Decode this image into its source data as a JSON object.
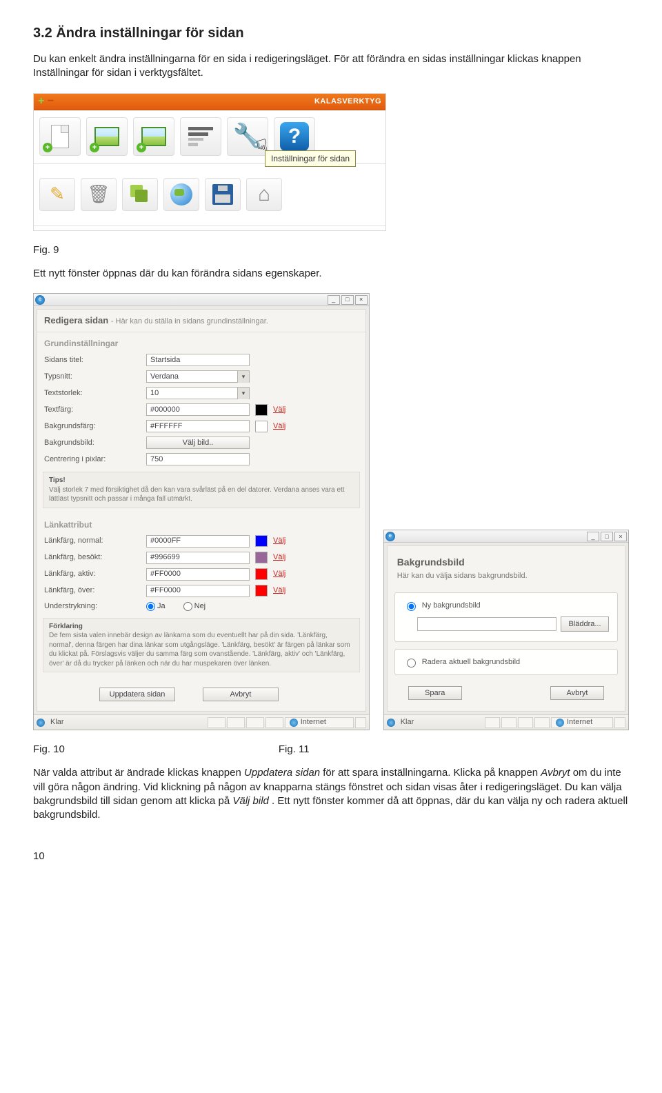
{
  "section": {
    "title": "3.2 Ändra inställningar för sidan"
  },
  "paragraphs": {
    "intro": "Du kan enkelt ändra inställningarna för en sida i redigeringsläget. För att förändra en sidas inställningar klickas  knappen Inställningar för sidan i verktygsfältet.",
    "after_fig9": "Ett nytt fönster öppnas där du kan förändra sidans egenskaper.",
    "final_1": "När valda attribut är ändrade klickas knappen ",
    "final_em1": "Uppdatera sidan",
    "final_2": " för att spara inställningarna. Klicka på knappen ",
    "final_em2": "Avbryt",
    "final_3": " om du inte vill göra någon ändring. Vid klickning på någon av knapparna stängs fönstret och sidan visas åter i redigeringsläget. Du kan välja bakgrundsbild till sidan genom att klicka på ",
    "final_em3": "Välj bild",
    "final_4": ". Ett nytt fönster kommer då att öppnas, där du kan välja ny och radera aktuell bakgrundsbild."
  },
  "figs": {
    "f9": "Fig. 9",
    "f10": "Fig. 10",
    "f11": "Fig. 11"
  },
  "toolbar": {
    "app_title": "KALASVERKTYG",
    "tooltip": "Inställningar för sidan"
  },
  "dlg1": {
    "title": "Redigera sidan",
    "subtitle": " -  Här kan du ställa in sidans grundinställningar.",
    "sect_basic": "Grundinställningar",
    "rows": {
      "titel": {
        "lbl": "Sidans titel:",
        "val": "Startsida"
      },
      "typsnitt": {
        "lbl": "Typsnitt:",
        "val": "Verdana"
      },
      "storlek": {
        "lbl": "Textstorlek:",
        "val": "10"
      },
      "textfarg": {
        "lbl": "Textfärg:",
        "val": "#000000",
        "sw": "#000000"
      },
      "bgfarg": {
        "lbl": "Bakgrundsfärg:",
        "val": "#FFFFFF",
        "sw": "#FFFFFF"
      },
      "bgbild": {
        "lbl": "Bakgrundsbild:",
        "val": "Välj bild.."
      },
      "center": {
        "lbl": "Centrering i pixlar:",
        "val": "750"
      }
    },
    "valj": "Välj",
    "tips_title": "Tips!",
    "tips_text": "Välj storlek 7 med försiktighet då den kan vara svårläst på en del datorer. Verdana anses vara ett lättläst typsnitt och passar i många fall utmärkt.",
    "sect_link": "Länkattribut",
    "links": {
      "normal": {
        "lbl": "Länkfärg, normal:",
        "val": "#0000FF",
        "sw": "#0000FF"
      },
      "besokt": {
        "lbl": "Länkfärg, besökt:",
        "val": "#996699",
        "sw": "#996699"
      },
      "aktiv": {
        "lbl": "Länkfärg, aktiv:",
        "val": "#FF0000",
        "sw": "#FF0000"
      },
      "over": {
        "lbl": "Länkfärg, över:",
        "val": "#FF0000",
        "sw": "#FF0000"
      }
    },
    "underline": {
      "lbl": "Understrykning:",
      "ja": "Ja",
      "nej": "Nej"
    },
    "expl_title": "Förklaring",
    "expl_text": "De fem sista valen innebär design av länkarna som du eventuellt har på din sida. 'Länkfärg, normal', denna färgen har dina länkar som utgångsläge. 'Länkfärg, besökt' är färgen på länkar som du klickat på. Förslagsvis väljer du samma färg som ovanstående. 'Länkfärg, aktiv' och 'Länkfärg, över' är då du trycker på länken och när du har muspekaren över länken.",
    "btn_update": "Uppdatera sidan",
    "btn_cancel": "Avbryt",
    "status_left": "Klar",
    "status_right": "Internet"
  },
  "dlg2": {
    "title": "Bakgrundsbild",
    "subtitle": "Här kan du välja sidans bakgrundsbild.",
    "opt_new": "Ny bakgrundsbild",
    "btn_browse": "Bläddra...",
    "opt_del": "Radera aktuell bakgrundsbild",
    "btn_save": "Spara",
    "btn_cancel": "Avbryt",
    "status_left": "Klar",
    "status_right": "Internet"
  },
  "page_number": "10"
}
